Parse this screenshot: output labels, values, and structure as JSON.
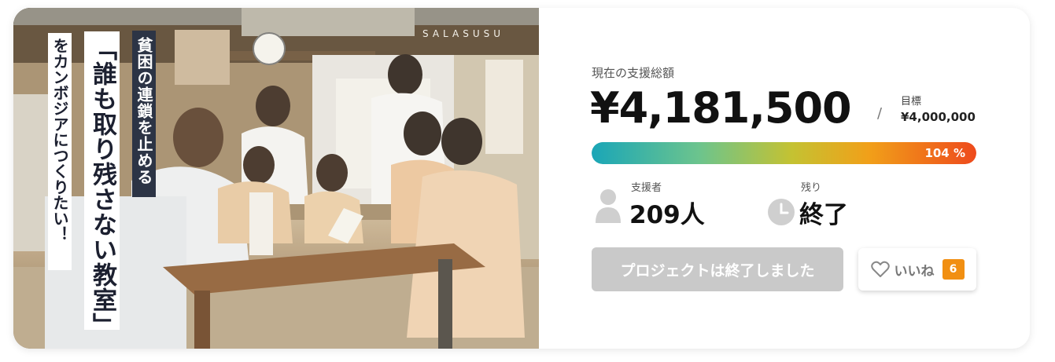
{
  "photo": {
    "brand": "SALASUSU",
    "headline_sub": "貧困の連鎖を止める",
    "headline_main": "「誰も取り残さない教室」",
    "headline_third": "をカンボジアにつくりたい！"
  },
  "funding": {
    "total_label": "現在の支援総額",
    "total_amount": "¥4,181,500",
    "slash": "/",
    "goal_label": "目標",
    "goal_amount": "¥4,000,000",
    "percent_text": "104 %",
    "percent_value": 104
  },
  "stats": {
    "backers_label": "支援者",
    "backers_value": "209人",
    "backers_icon": "person-icon",
    "remaining_label": "残り",
    "remaining_value": "終了",
    "remaining_icon": "clock-icon"
  },
  "actions": {
    "ended_label": "プロジェクトは終了しました",
    "like_icon": "heart-outline-icon",
    "like_label": "いいね",
    "like_count": "6"
  },
  "colors": {
    "progress_start": "#1aa6b7",
    "progress_end": "#ee4a1c",
    "like_badge": "#f18f12",
    "ended_button": "#c9c9c9",
    "headline_box": "#2c3445"
  }
}
